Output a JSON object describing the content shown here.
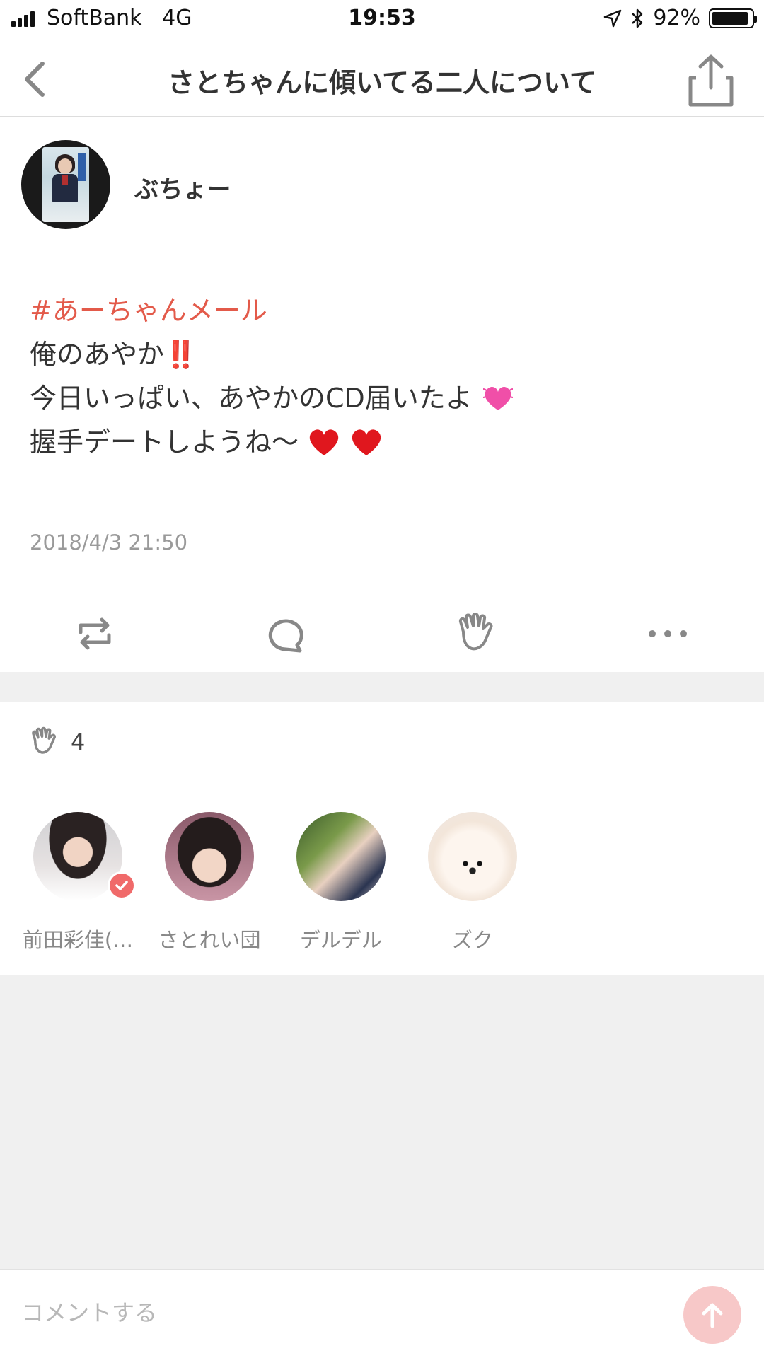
{
  "status_bar": {
    "carrier": "SoftBank",
    "network": "4G",
    "time": "19:53",
    "battery": "92%",
    "battery_level": 0.92
  },
  "nav": {
    "title": "さとちゃんに傾いてる二人について",
    "back_icon": "chevron-left-icon",
    "share_icon": "share-icon"
  },
  "post": {
    "author": "ぶちょー",
    "hashtag": "#あーちゃんメール",
    "line1": "俺のあやか",
    "line1_emoji": "‼️",
    "line2": "今日いっぱい、あやかのCD届いたよ",
    "line3": "握手デートしようね〜",
    "date": "2018/4/3 21:50"
  },
  "actions": [
    {
      "icon": "repost-icon"
    },
    {
      "icon": "comment-icon"
    },
    {
      "icon": "clap-icon"
    },
    {
      "icon": "more-icon"
    }
  ],
  "likes": {
    "icon": "clap-icon",
    "count": "4",
    "users": [
      {
        "name": "前田彩佳(…",
        "verified": true
      },
      {
        "name": "さとれい団",
        "verified": false
      },
      {
        "name": "デルデル",
        "verified": false
      },
      {
        "name": "ズク",
        "verified": false
      }
    ]
  },
  "comment": {
    "placeholder": "コメントする"
  },
  "colors": {
    "hashtag": "#e35a4a",
    "send_button": "#f7c8c8",
    "verified_badge": "#f06a6a"
  }
}
